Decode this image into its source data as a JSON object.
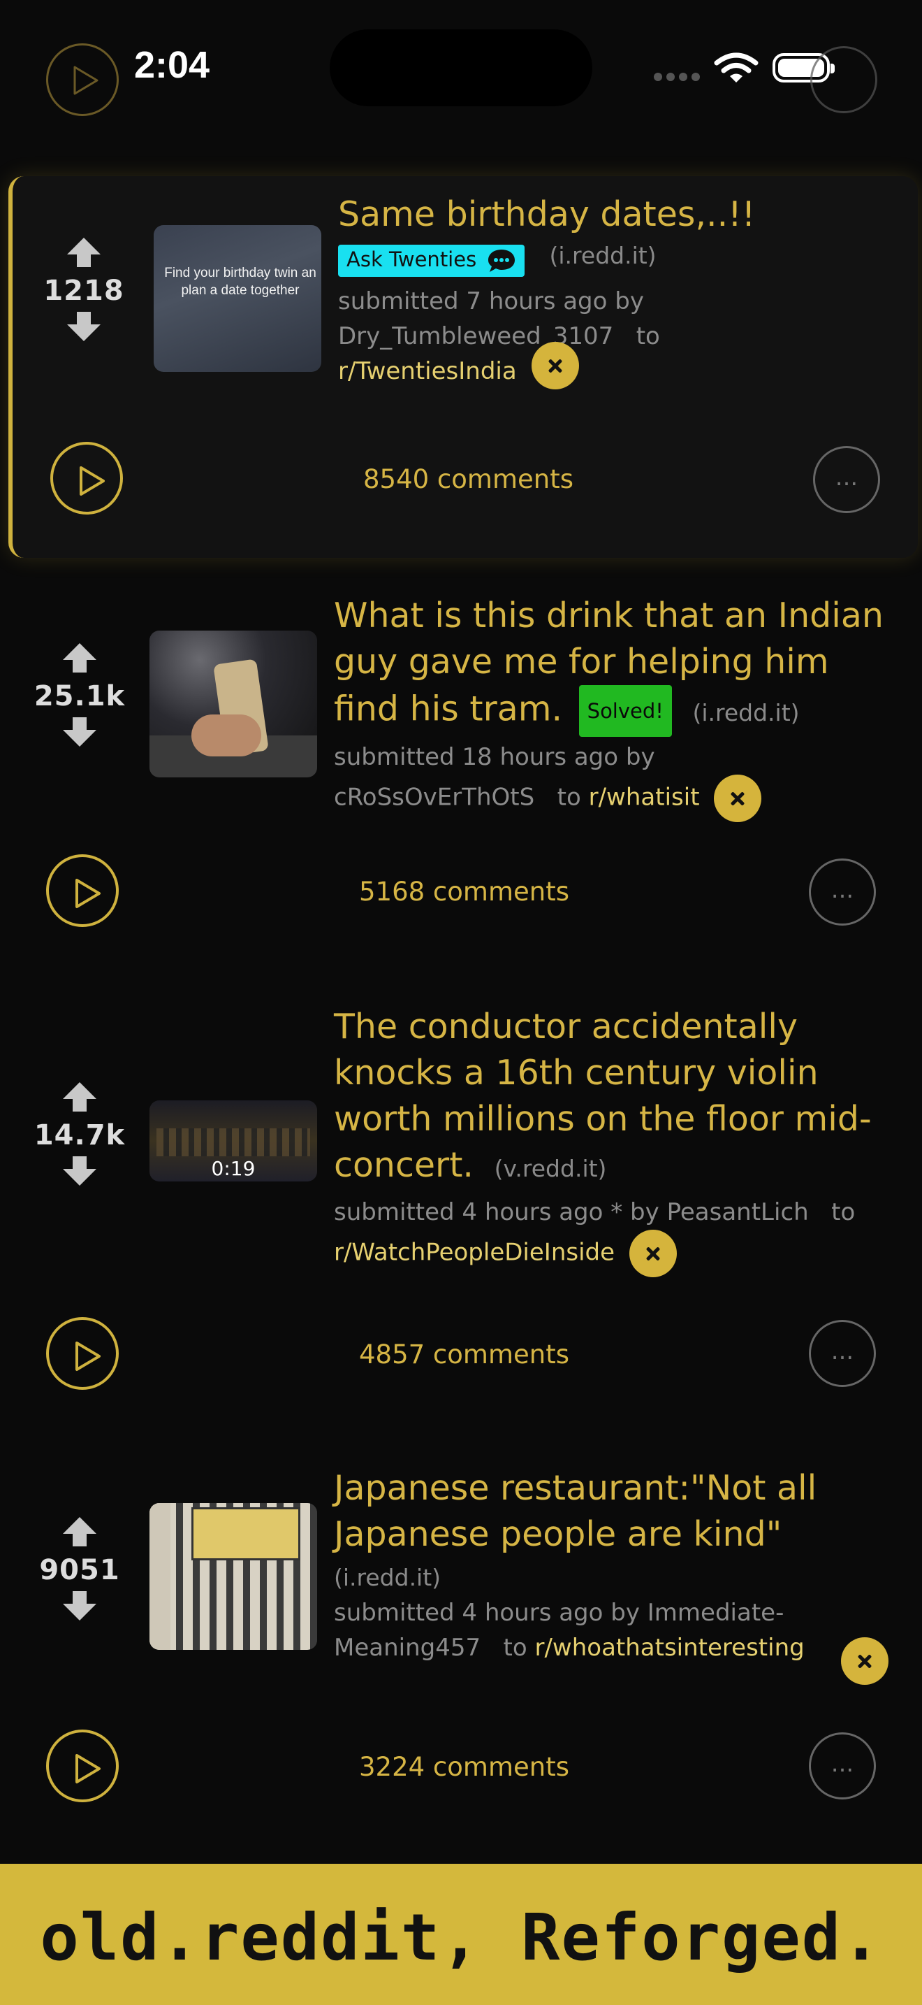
{
  "status_bar": {
    "time": "2:04"
  },
  "posts": [
    {
      "score": "1218",
      "title": "Same birthday dates,..!!",
      "flair": "Ask Twenties",
      "domain": "(i.redd.it)",
      "meta_prefix": "submitted 7 hours ago by",
      "author": "Dry_Tumbleweed_3107",
      "to": "to",
      "subreddit": "r/TwentiesIndia",
      "comments": "8540 comments",
      "thumb_text": "Find your birthday twin an plan a date together"
    },
    {
      "score": "25.1k",
      "title": "What is this drink that an Indian guy gave me for helping him find his tram.",
      "flair": "Solved!",
      "domain": "(i.redd.it)",
      "meta_prefix": "submitted 18 hours ago by",
      "author": "cRoSsOvErThOtS",
      "to": "to",
      "subreddit": "r/whatisit",
      "comments": "5168 comments"
    },
    {
      "score": "14.7k",
      "title": "The conductor accidentally knocks a 16th century violin worth millions on the floor mid-concert.",
      "domain": "(v.redd.it)",
      "meta_prefix": "submitted 4 hours ago * by",
      "author": "PeasantLich",
      "to": "to",
      "subreddit": "r/WatchPeopleDieInside",
      "comments": "4857 comments",
      "duration": "0:19"
    },
    {
      "score": "9051",
      "title": "Japanese restaurant:\"Not all Japanese people are kind\"",
      "domain": "(i.redd.it)",
      "meta_prefix": "submitted 4 hours ago by",
      "author": "Immediate-Meaning457",
      "to": "to",
      "subreddit": "r/whoathatsinteresting",
      "comments": "3224 comments"
    }
  ],
  "more_label": "...",
  "footer": {
    "tagline": "old.reddit, Reforged."
  },
  "colors": {
    "accent": "#d6b545",
    "background": "#0a0a0a",
    "flair_cyan": "#19e0f0",
    "flair_green": "#21b921",
    "footer": "#d4b83c"
  },
  "icons": [
    "play-icon",
    "upvote-icon",
    "downvote-icon",
    "close-icon",
    "chat-bubble-icon",
    "wifi-icon",
    "battery-icon"
  ]
}
